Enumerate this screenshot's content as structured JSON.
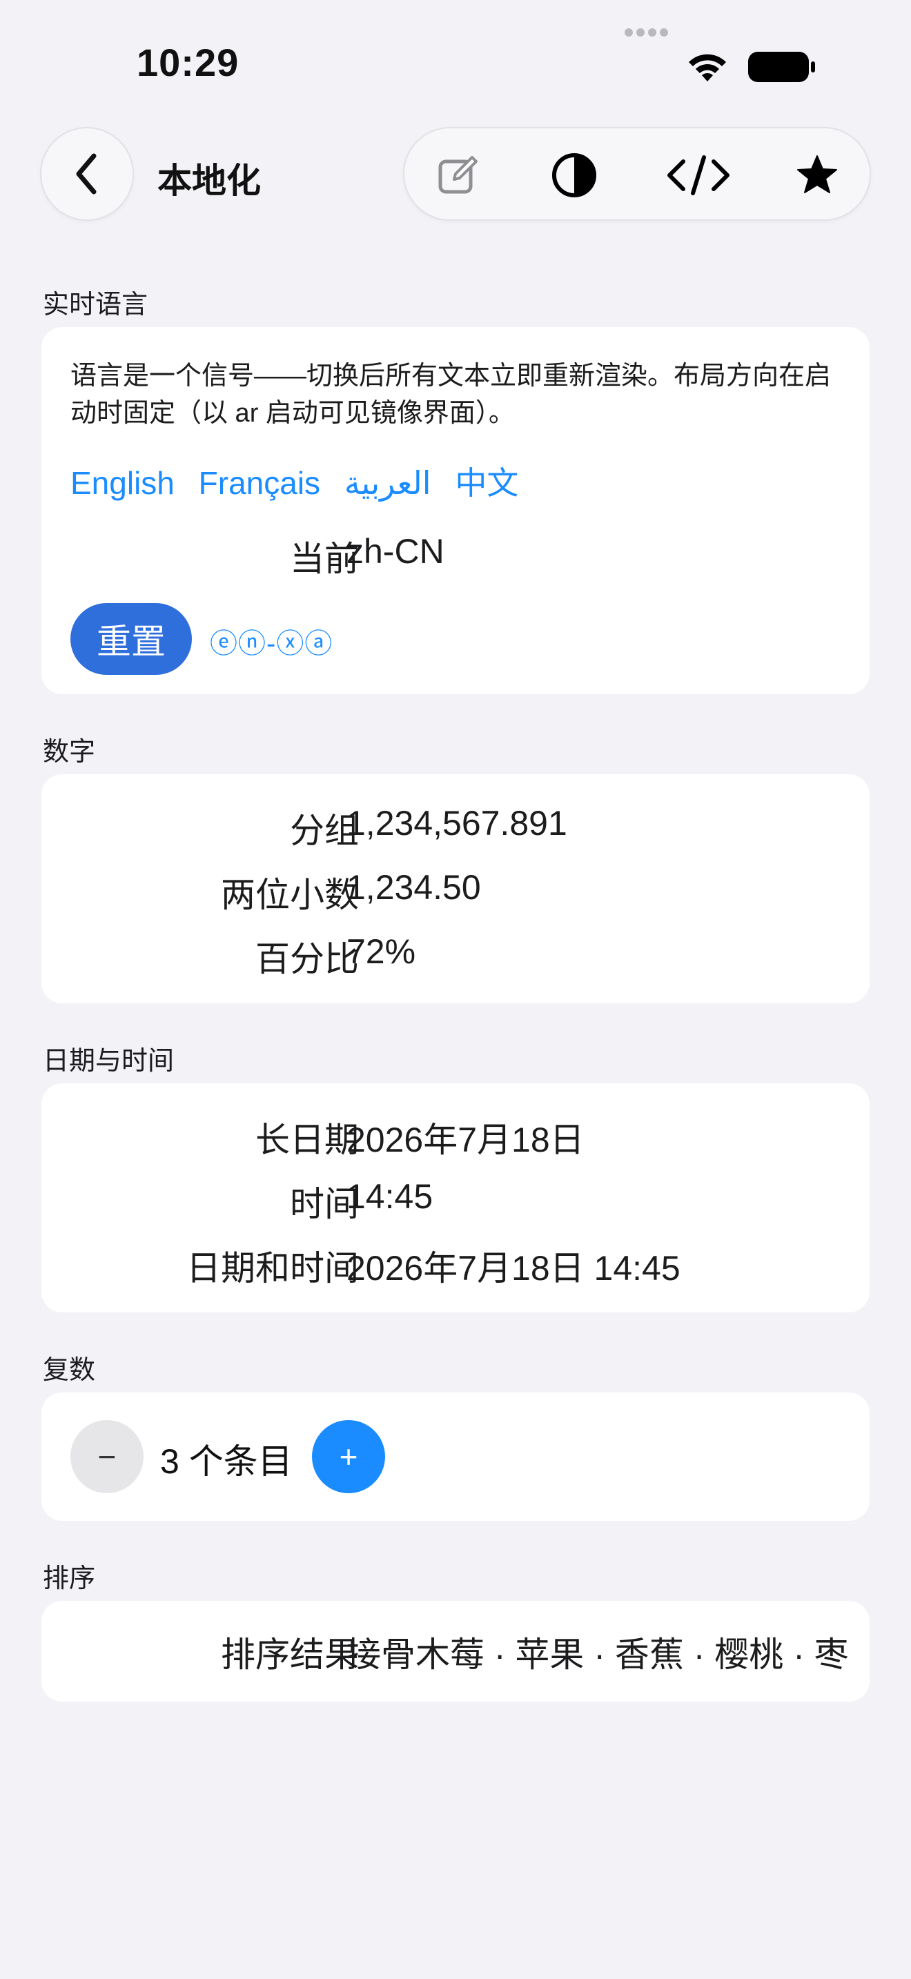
{
  "status_bar": {
    "time": "10:29"
  },
  "nav": {
    "title": "本地化"
  },
  "sections": {
    "live_language": {
      "label": "实时语言",
      "description": "语言是一个信号——切换后所有文本立即重新渲染。布局方向在启动时固定（以 ar 启动可见镜像界面）。",
      "languages": [
        "English",
        "Français",
        "العربية",
        "中文"
      ],
      "current_key": "当前",
      "current_value": "zh-CN",
      "reset_label": "重置",
      "pseudo_locale_label": "ⓔⓝ-ⓧⓐ"
    },
    "numbers": {
      "label": "数字",
      "rows": [
        {
          "key": "分组",
          "value": "1,234,567.891"
        },
        {
          "key": "两位小数",
          "value": "1,234.50"
        },
        {
          "key": "百分比",
          "value": "72%"
        }
      ]
    },
    "date_time": {
      "label": "日期与时间",
      "rows": [
        {
          "key": "长日期",
          "value": "2026年7月18日"
        },
        {
          "key": "时间",
          "value": "14:45"
        },
        {
          "key": "日期和时间",
          "value": "2026年7月18日 14:45"
        }
      ]
    },
    "plurals": {
      "label": "复数",
      "minus": "−",
      "count_text": "3 个条目",
      "plus": "+"
    },
    "sorting": {
      "label": "排序",
      "key": "排序结果",
      "value": "接骨木莓 · 苹果 · 香蕉 · 樱桃 · 枣"
    }
  },
  "colors": {
    "accent": "#1a8cff",
    "reset_button": "#2f6fdc",
    "background": "#f2f2f7"
  },
  "icons": [
    "chevron-left-icon",
    "edit-icon",
    "contrast-icon",
    "code-icon",
    "star-icon",
    "wifi-icon",
    "battery-icon"
  ]
}
